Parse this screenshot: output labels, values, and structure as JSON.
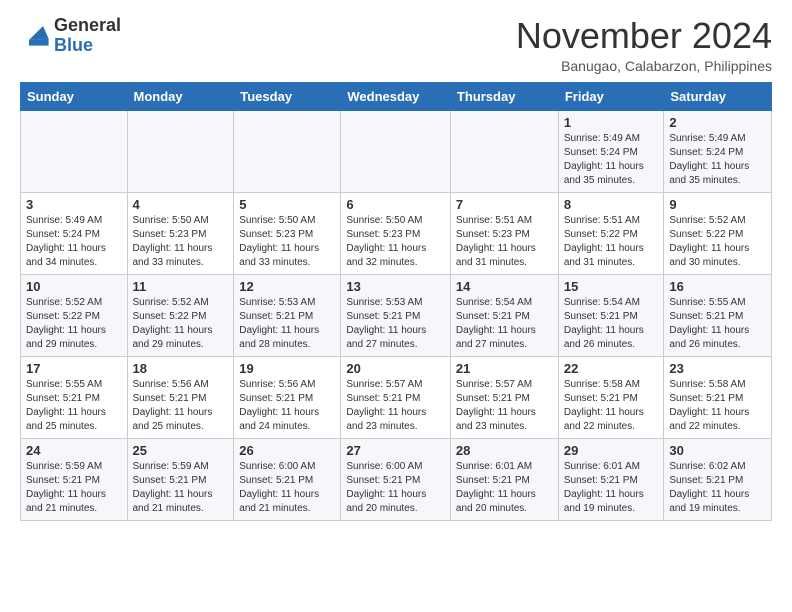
{
  "header": {
    "logo": {
      "general": "General",
      "blue": "Blue"
    },
    "title": "November 2024",
    "location": "Banugao, Calabarzon, Philippines"
  },
  "weekdays": [
    "Sunday",
    "Monday",
    "Tuesday",
    "Wednesday",
    "Thursday",
    "Friday",
    "Saturday"
  ],
  "weeks": [
    [
      {
        "day": "",
        "info": ""
      },
      {
        "day": "",
        "info": ""
      },
      {
        "day": "",
        "info": ""
      },
      {
        "day": "",
        "info": ""
      },
      {
        "day": "",
        "info": ""
      },
      {
        "day": "1",
        "info": "Sunrise: 5:49 AM\nSunset: 5:24 PM\nDaylight: 11 hours and 35 minutes."
      },
      {
        "day": "2",
        "info": "Sunrise: 5:49 AM\nSunset: 5:24 PM\nDaylight: 11 hours and 35 minutes."
      }
    ],
    [
      {
        "day": "3",
        "info": "Sunrise: 5:49 AM\nSunset: 5:24 PM\nDaylight: 11 hours and 34 minutes."
      },
      {
        "day": "4",
        "info": "Sunrise: 5:50 AM\nSunset: 5:23 PM\nDaylight: 11 hours and 33 minutes."
      },
      {
        "day": "5",
        "info": "Sunrise: 5:50 AM\nSunset: 5:23 PM\nDaylight: 11 hours and 33 minutes."
      },
      {
        "day": "6",
        "info": "Sunrise: 5:50 AM\nSunset: 5:23 PM\nDaylight: 11 hours and 32 minutes."
      },
      {
        "day": "7",
        "info": "Sunrise: 5:51 AM\nSunset: 5:23 PM\nDaylight: 11 hours and 31 minutes."
      },
      {
        "day": "8",
        "info": "Sunrise: 5:51 AM\nSunset: 5:22 PM\nDaylight: 11 hours and 31 minutes."
      },
      {
        "day": "9",
        "info": "Sunrise: 5:52 AM\nSunset: 5:22 PM\nDaylight: 11 hours and 30 minutes."
      }
    ],
    [
      {
        "day": "10",
        "info": "Sunrise: 5:52 AM\nSunset: 5:22 PM\nDaylight: 11 hours and 29 minutes."
      },
      {
        "day": "11",
        "info": "Sunrise: 5:52 AM\nSunset: 5:22 PM\nDaylight: 11 hours and 29 minutes."
      },
      {
        "day": "12",
        "info": "Sunrise: 5:53 AM\nSunset: 5:21 PM\nDaylight: 11 hours and 28 minutes."
      },
      {
        "day": "13",
        "info": "Sunrise: 5:53 AM\nSunset: 5:21 PM\nDaylight: 11 hours and 27 minutes."
      },
      {
        "day": "14",
        "info": "Sunrise: 5:54 AM\nSunset: 5:21 PM\nDaylight: 11 hours and 27 minutes."
      },
      {
        "day": "15",
        "info": "Sunrise: 5:54 AM\nSunset: 5:21 PM\nDaylight: 11 hours and 26 minutes."
      },
      {
        "day": "16",
        "info": "Sunrise: 5:55 AM\nSunset: 5:21 PM\nDaylight: 11 hours and 26 minutes."
      }
    ],
    [
      {
        "day": "17",
        "info": "Sunrise: 5:55 AM\nSunset: 5:21 PM\nDaylight: 11 hours and 25 minutes."
      },
      {
        "day": "18",
        "info": "Sunrise: 5:56 AM\nSunset: 5:21 PM\nDaylight: 11 hours and 25 minutes."
      },
      {
        "day": "19",
        "info": "Sunrise: 5:56 AM\nSunset: 5:21 PM\nDaylight: 11 hours and 24 minutes."
      },
      {
        "day": "20",
        "info": "Sunrise: 5:57 AM\nSunset: 5:21 PM\nDaylight: 11 hours and 23 minutes."
      },
      {
        "day": "21",
        "info": "Sunrise: 5:57 AM\nSunset: 5:21 PM\nDaylight: 11 hours and 23 minutes."
      },
      {
        "day": "22",
        "info": "Sunrise: 5:58 AM\nSunset: 5:21 PM\nDaylight: 11 hours and 22 minutes."
      },
      {
        "day": "23",
        "info": "Sunrise: 5:58 AM\nSunset: 5:21 PM\nDaylight: 11 hours and 22 minutes."
      }
    ],
    [
      {
        "day": "24",
        "info": "Sunrise: 5:59 AM\nSunset: 5:21 PM\nDaylight: 11 hours and 21 minutes."
      },
      {
        "day": "25",
        "info": "Sunrise: 5:59 AM\nSunset: 5:21 PM\nDaylight: 11 hours and 21 minutes."
      },
      {
        "day": "26",
        "info": "Sunrise: 6:00 AM\nSunset: 5:21 PM\nDaylight: 11 hours and 21 minutes."
      },
      {
        "day": "27",
        "info": "Sunrise: 6:00 AM\nSunset: 5:21 PM\nDaylight: 11 hours and 20 minutes."
      },
      {
        "day": "28",
        "info": "Sunrise: 6:01 AM\nSunset: 5:21 PM\nDaylight: 11 hours and 20 minutes."
      },
      {
        "day": "29",
        "info": "Sunrise: 6:01 AM\nSunset: 5:21 PM\nDaylight: 11 hours and 19 minutes."
      },
      {
        "day": "30",
        "info": "Sunrise: 6:02 AM\nSunset: 5:21 PM\nDaylight: 11 hours and 19 minutes."
      }
    ]
  ]
}
